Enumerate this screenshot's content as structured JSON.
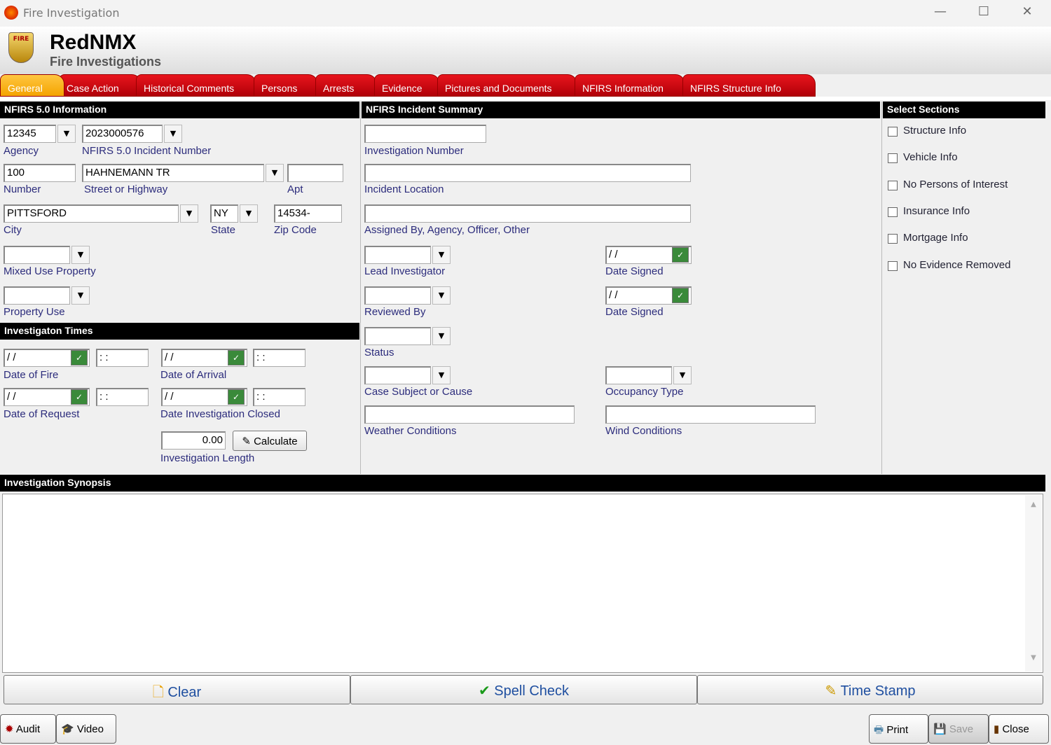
{
  "window": {
    "title": "Fire Investigation",
    "minimize": "—",
    "maximize": "☐",
    "close": "✕"
  },
  "header": {
    "brand": "RedNMX",
    "subtitle": "Fire Investigations",
    "logo_text": "FIRE"
  },
  "tabs": [
    "General",
    "Case Action",
    "Historical Comments",
    "Persons",
    "Arrests",
    "Evidence",
    "Pictures and Documents",
    "NFIRS Information",
    "NFIRS Structure Info"
  ],
  "nfirs": {
    "title": "NFIRS 5.0 Information",
    "agency": "12345",
    "agency_label": "Agency",
    "incident_number": "2023000576",
    "incident_label": "NFIRS 5.0 Incident Number",
    "number": "100",
    "number_label": "Number",
    "street": "HAHNEMANN TR",
    "street_label": "Street or Highway",
    "apt": "",
    "apt_label": "Apt",
    "city": "PITTSFORD",
    "city_label": "City",
    "state": "NY",
    "state_label": "State",
    "zip": "14534-",
    "zip_label": "Zip Code",
    "mixed_use_label": "Mixed Use Property",
    "property_use_label": "Property Use"
  },
  "times": {
    "title": "Investigaton Times",
    "date_placeholder": " / /",
    "time_placeholder": " : :",
    "date_of_fire": "Date of Fire",
    "date_of_arrival": "Date of Arrival",
    "date_of_request": "Date of Request",
    "date_closed": "Date Investigation Closed",
    "length": "0.00",
    "length_label": "Investigation Length",
    "calculate": "Calculate"
  },
  "summary": {
    "title": "NFIRS Incident Summary",
    "investigation_number_label": "Investigation  Number",
    "incident_location_label": "Incident Location",
    "assigned_by_label": "Assigned By, Agency, Officer, Other",
    "lead_investigator_label": "Lead Investigator",
    "date_signed_label": "Date Signed",
    "reviewed_by_label": "Reviewed By",
    "status_label": "Status",
    "case_subject_label": "Case Subject or Cause",
    "occupancy_label": "Occupancy Type",
    "weather_label": "Weather Conditions",
    "wind_label": "Wind Conditions",
    "date_placeholder": " / /"
  },
  "sections": {
    "title": "Select Sections",
    "items": [
      "Structure Info",
      "Vehicle Info",
      "No Persons of Interest",
      "Insurance Info",
      "Mortgage Info",
      "No Evidence Removed"
    ]
  },
  "synopsis": {
    "title": "Investigation Synopsis",
    "text": "",
    "clear": "Clear",
    "spell": "Spell Check",
    "timestamp": "Time Stamp"
  },
  "footer": {
    "audit": "Audit",
    "video": "Video",
    "print": "Print",
    "save": "Save",
    "close": "Close"
  }
}
